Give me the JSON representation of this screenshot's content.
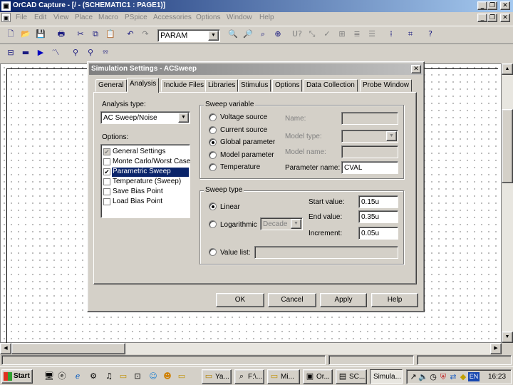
{
  "window": {
    "title": "OrCAD Capture - [/ - (SCHEMATIC1 : PAGE1)]"
  },
  "menu": [
    "File",
    "Edit",
    "View",
    "Place",
    "Macro",
    "PSpice",
    "Accessories",
    "Options",
    "Window",
    "Help"
  ],
  "toolbar": {
    "part_combo_value": "PARAM"
  },
  "dialog": {
    "title": "Simulation Settings - ACSweep",
    "tabs": [
      "General",
      "Analysis",
      "Include Files",
      "Libraries",
      "Stimulus",
      "Options",
      "Data Collection",
      "Probe Window"
    ],
    "analysis_type_label": "Analysis type:",
    "analysis_type_value": "AC Sweep/Noise",
    "options_label": "Options:",
    "options": [
      "General Settings",
      "Monte Carlo/Worst Case",
      "Parametric Sweep",
      "Temperature (Sweep)",
      "Save Bias Point",
      "Load Bias Point"
    ],
    "sweep_variable": {
      "label": "Sweep variable",
      "radios": [
        "Voltage source",
        "Current source",
        "Global parameter",
        "Model parameter",
        "Temperature"
      ],
      "selected": "Global parameter",
      "name_label": "Name:",
      "model_type_label": "Model type:",
      "model_name_label": "Model name:",
      "parameter_name_label": "Parameter name:",
      "parameter_name_value": "CVAL"
    },
    "sweep_type": {
      "label": "Sweep type",
      "linear": "Linear",
      "logarithmic": "Logarithmic",
      "log_scale_value": "Decade",
      "start_label": "Start value:",
      "start_value": "0.15u",
      "end_label": "End value:",
      "end_value": "0.35u",
      "increment_label": "Increment:",
      "increment_value": "0.05u",
      "value_list_label": "Value list:"
    },
    "buttons": {
      "ok": "OK",
      "cancel": "Cancel",
      "apply": "Apply",
      "help": "Help"
    }
  },
  "taskbar": {
    "start_label": "Start",
    "tasks": [
      "Ya...",
      "F:\\...",
      "Mi...",
      "Or...",
      "SC...",
      "Simula..."
    ],
    "tray": {
      "lang": "EN",
      "clock": "16:23"
    }
  }
}
